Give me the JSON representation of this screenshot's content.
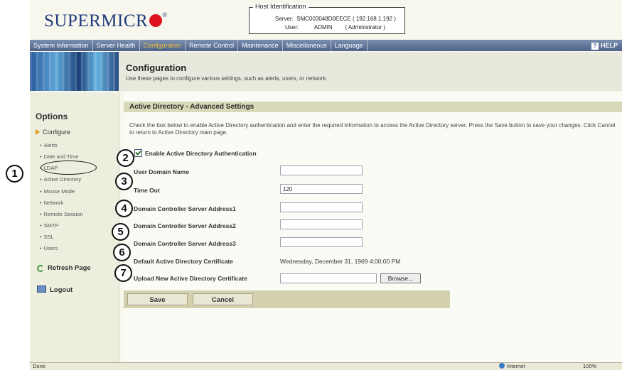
{
  "header": {
    "logo_text": "SUPERMICR",
    "logo_reg": "®",
    "host_legend": "Host Identification",
    "server_line": "Server:  SMC003048D0EECE ( 192.168.1.192 )",
    "user_line": "User:          ADMIN        ( Administrator )"
  },
  "nav": {
    "items": [
      {
        "label": "System Information"
      },
      {
        "label": "Server Health"
      },
      {
        "label": "Configuration",
        "active": true
      },
      {
        "label": "Remote Control"
      },
      {
        "label": "Maintenance"
      },
      {
        "label": "Miscellaneous"
      },
      {
        "label": "Language"
      }
    ],
    "help_label": "HELP",
    "help_icon_text": "?"
  },
  "banner": {
    "title": "Configuration",
    "subtitle": "Use these pages to configure various settings, such as alerts, users, or network."
  },
  "sidebar": {
    "heading": "Options",
    "configure_label": "Configure",
    "items": [
      {
        "label": "Alerts"
      },
      {
        "label": "Date and Time"
      },
      {
        "label": "LDAP"
      },
      {
        "label": "Active Directory"
      },
      {
        "label": "Mouse Mode"
      },
      {
        "label": "Network"
      },
      {
        "label": "Remote Session"
      },
      {
        "label": "SMTP"
      },
      {
        "label": "SSL"
      },
      {
        "label": "Users"
      }
    ],
    "refresh_label": "Refresh Page",
    "logout_label": "Logout"
  },
  "main": {
    "section_title": "Active Directory - Advanced Settings",
    "description": "Check the box below to enable Active Directory authentication and enter the required information to access the Active Directory server. Press the Save button to save your changes. Click Cancel to return to Active Directory main page.",
    "enable_label": "Enable Active Directory Authentication",
    "enable_checked": true,
    "fields": {
      "user_domain": {
        "label": "User Domain Name",
        "value": ""
      },
      "timeout": {
        "label": "Time Out",
        "value": "120"
      },
      "dc1": {
        "label": "Domain Controller Server Address1",
        "value": ""
      },
      "dc2": {
        "label": "Domain Controller Server Address2",
        "value": ""
      },
      "dc3": {
        "label": "Domain Controller Server Address3",
        "value": ""
      }
    },
    "default_cert_label": "Default Active Directory Certificate",
    "default_cert_value": "Wednesday, December 31, 1969 4:00:00 PM",
    "upload_label": "Upload New Active Directory Certificate",
    "upload_value": "",
    "browse_label": "Browse...",
    "save_label": "Save",
    "cancel_label": "Cancel"
  },
  "statusbar": {
    "left": "Done",
    "zone": "Internet",
    "zoom": "100%"
  },
  "callouts": [
    "1",
    "2",
    "3",
    "4",
    "5",
    "6",
    "7"
  ],
  "colors": {
    "nav_bg": "#4d6188",
    "nav_active": "#f3c33b",
    "logo_blue": "#1f3a7a",
    "logo_red": "#e0141e",
    "section_bar": "#d9d8b8"
  }
}
